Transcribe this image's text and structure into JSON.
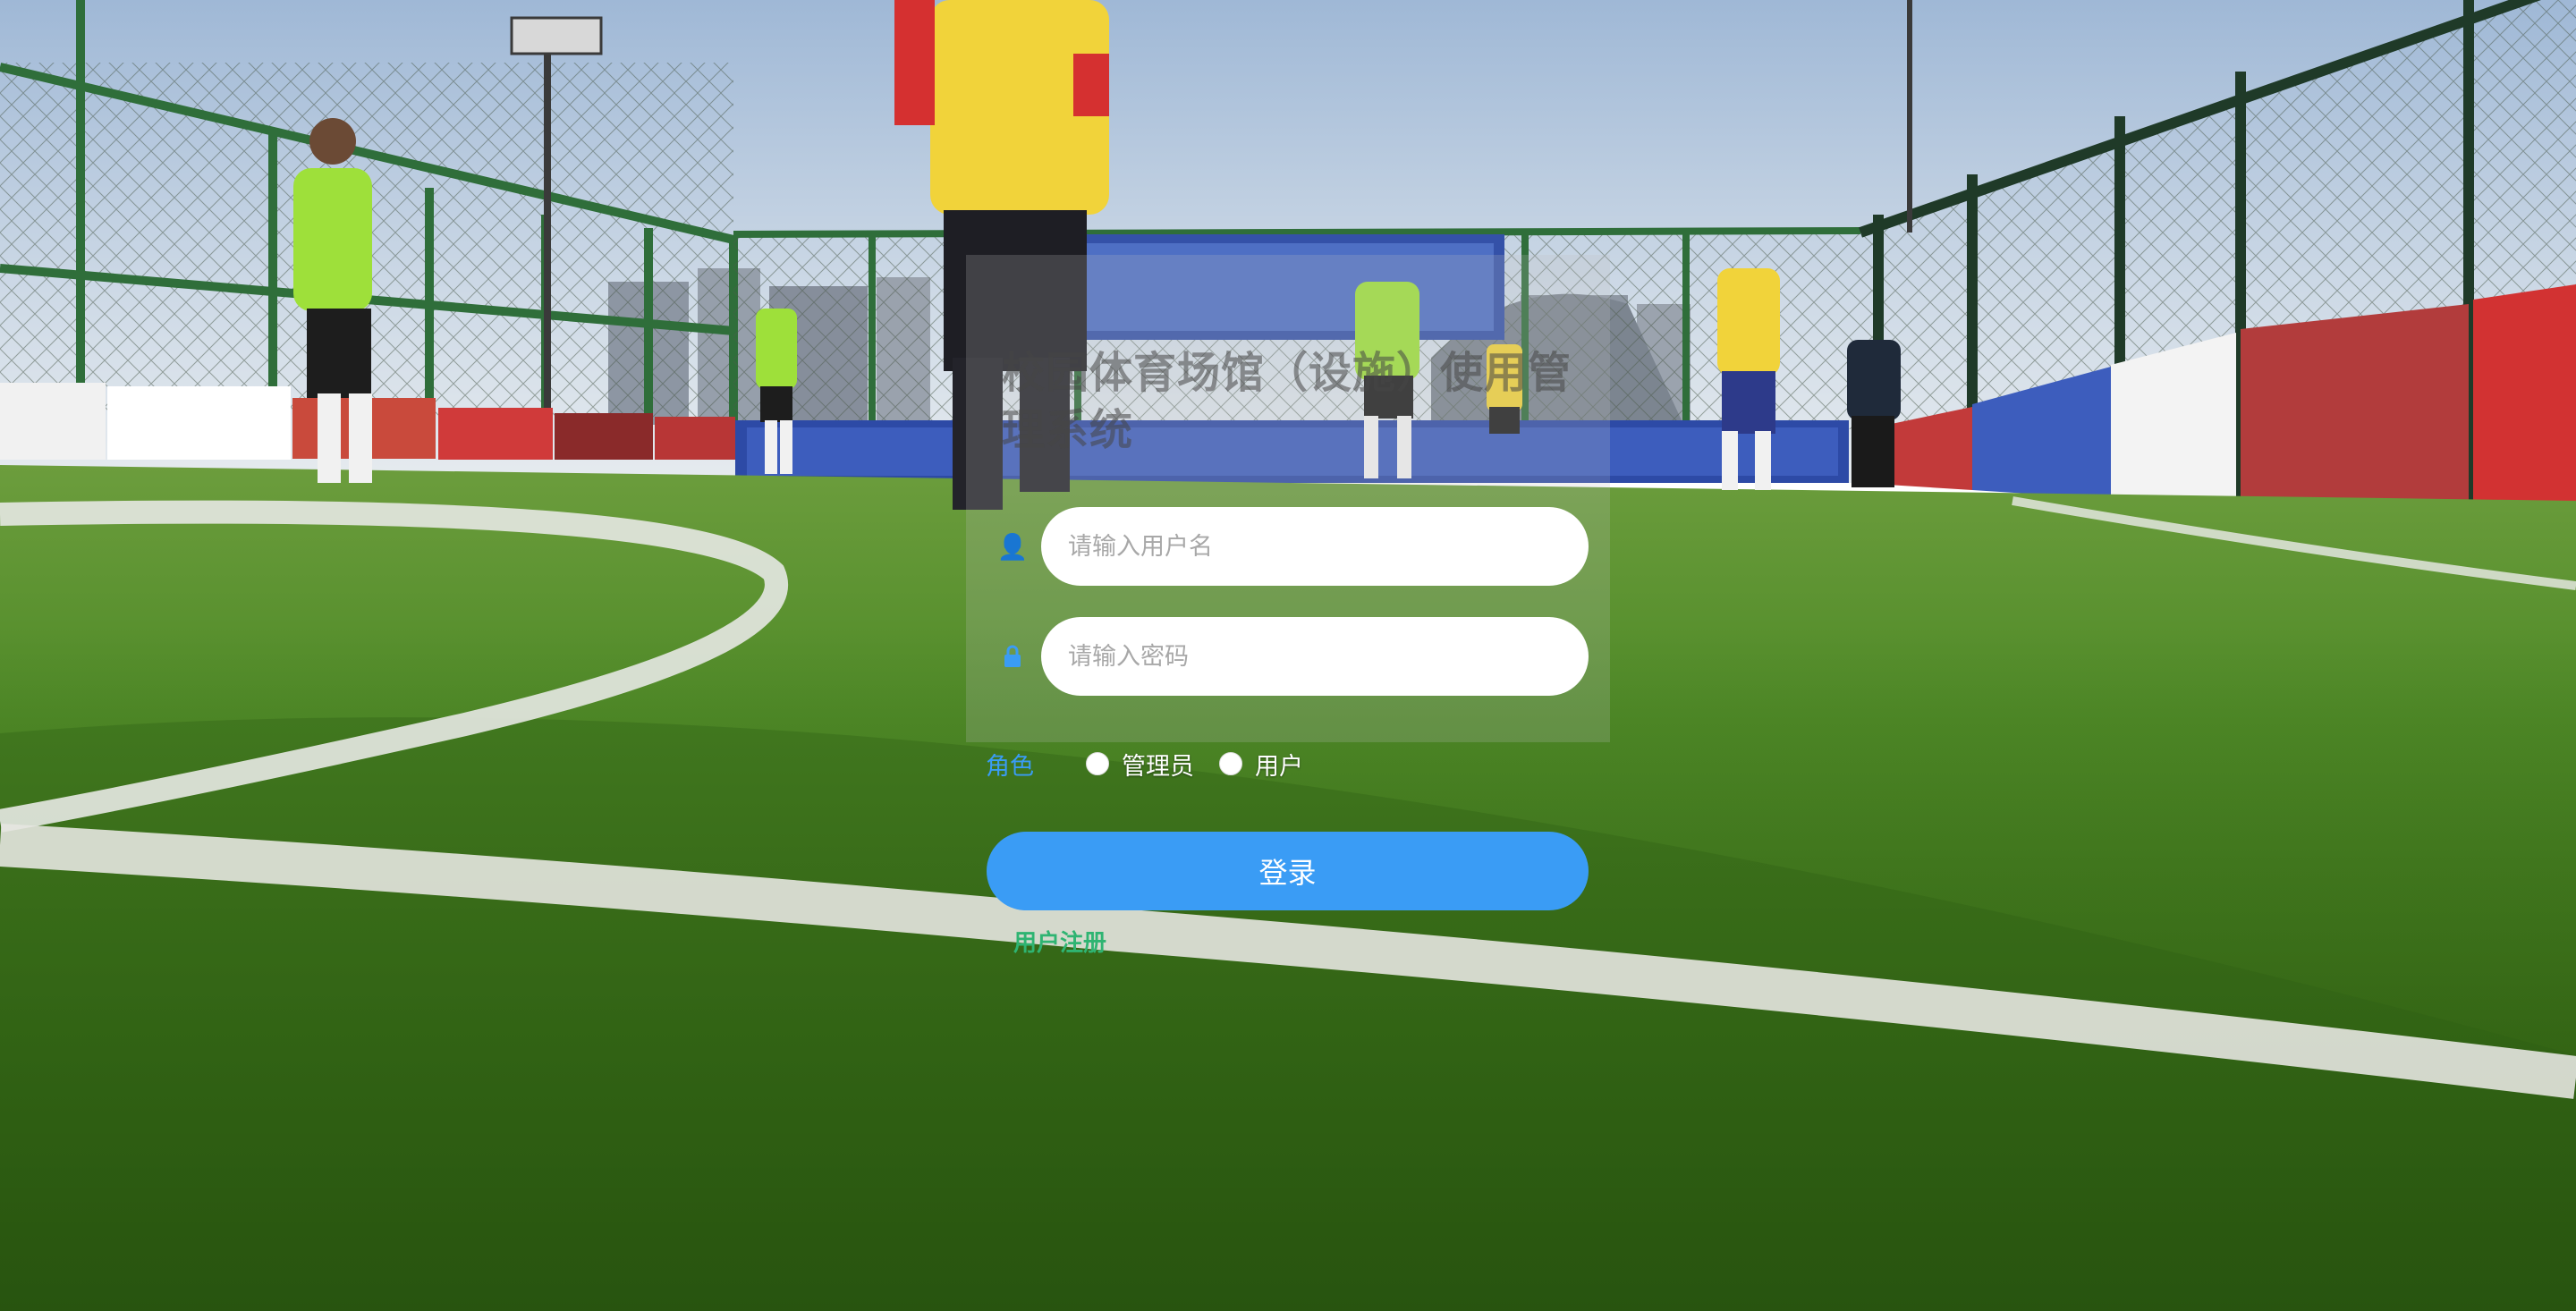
{
  "page": {
    "title": "校园体育场馆（设施）使用管理系统"
  },
  "form": {
    "username_placeholder": "请输入用户名",
    "password_placeholder": "请输入密码",
    "role_label": "角色",
    "roles": [
      {
        "label": "管理员",
        "selected": false
      },
      {
        "label": "用户",
        "selected": false
      }
    ],
    "login_label": "登录",
    "register_label": "用户注册"
  },
  "icons": {
    "username": "user-icon",
    "password": "lock-icon"
  },
  "colors": {
    "accent": "#3a9cf5",
    "register_link": "#2fb472",
    "title": "#464646"
  }
}
